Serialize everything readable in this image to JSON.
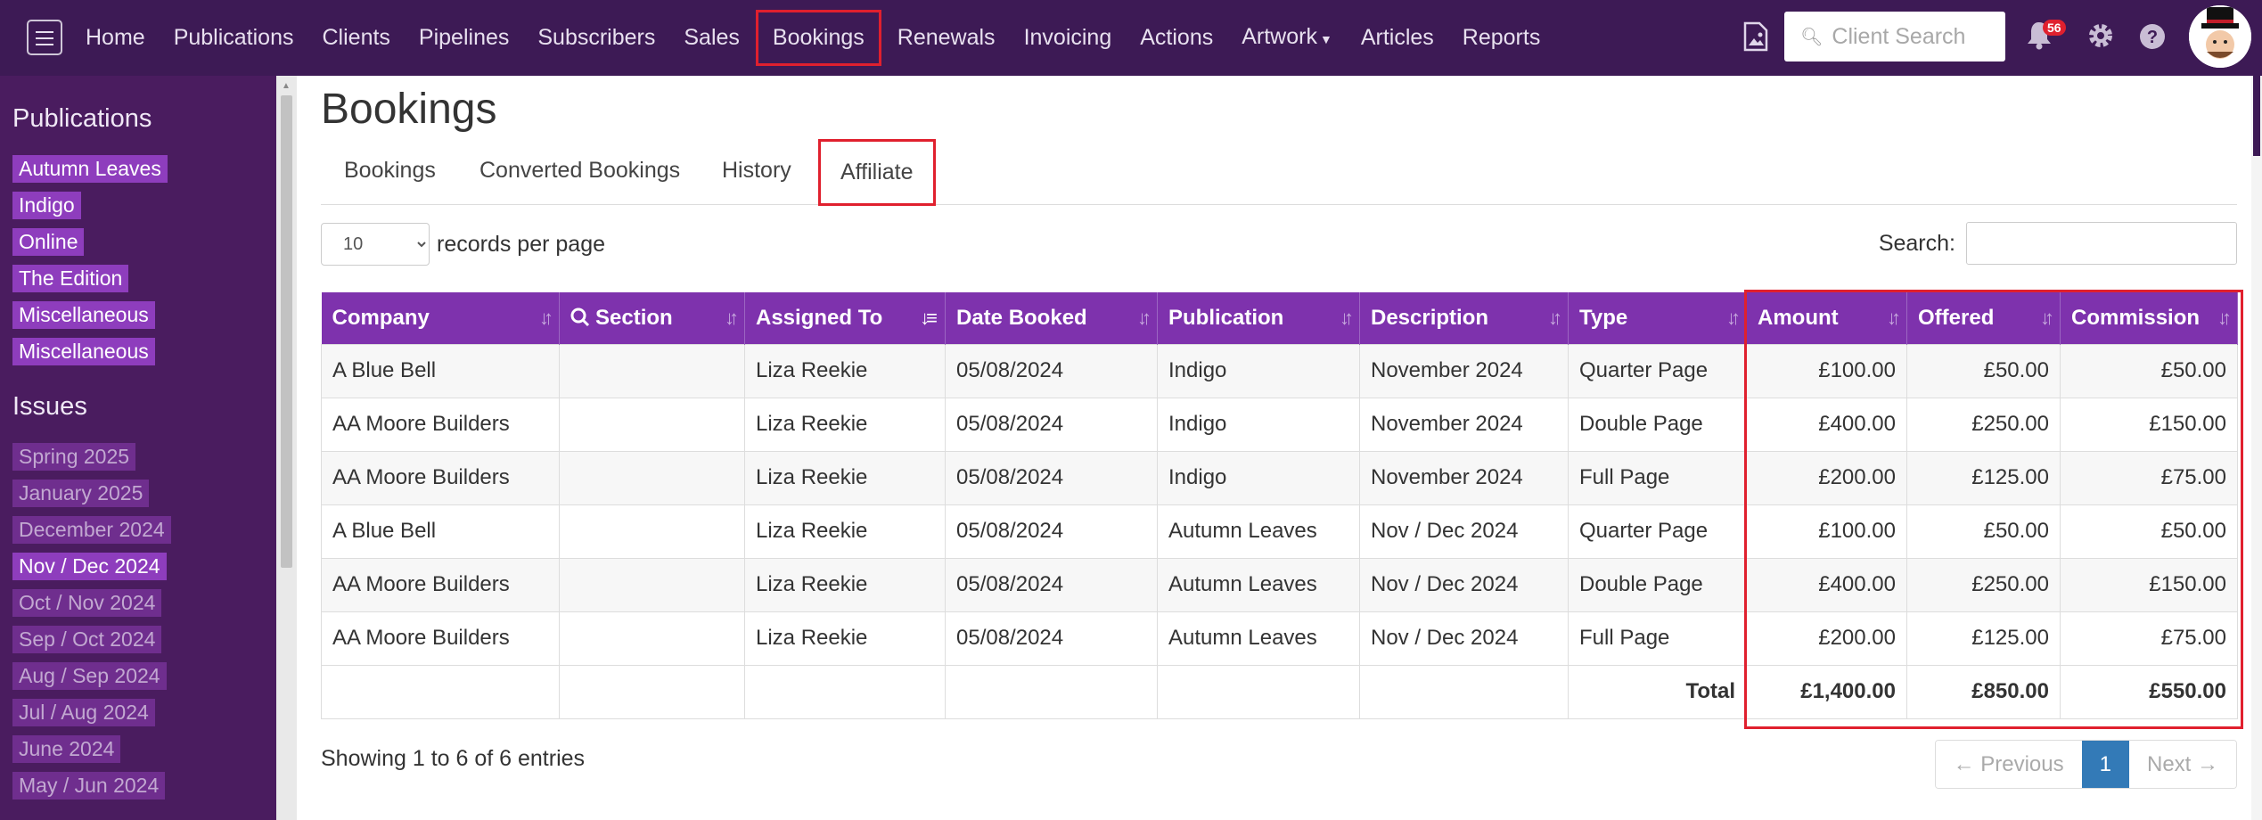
{
  "nav": {
    "items": [
      "Home",
      "Publications",
      "Clients",
      "Pipelines",
      "Subscribers",
      "Sales",
      "Bookings",
      "Renewals",
      "Invoicing",
      "Actions",
      "Artwork",
      "Articles",
      "Reports"
    ],
    "active": "Bookings",
    "search_placeholder": "Client Search",
    "notification_count": "56"
  },
  "sidebar": {
    "publications_heading": "Publications",
    "publications": [
      "Autumn Leaves",
      "Indigo",
      "Online",
      "The Edition",
      "Miscellaneous",
      "Miscellaneous"
    ],
    "issues_heading": "Issues",
    "issues": [
      "Spring 2025",
      "January 2025",
      "December 2024",
      "Nov / Dec 2024",
      "Oct / Nov 2024",
      "Sep / Oct 2024",
      "Aug / Sep 2024",
      "Jul / Aug 2024",
      "June 2024",
      "May / Jun 2024"
    ],
    "active_issue": "Nov / Dec 2024"
  },
  "page": {
    "title": "Bookings",
    "tabs": [
      "Bookings",
      "Converted Bookings",
      "History",
      "Affiliate"
    ],
    "active_tab": "Affiliate",
    "length_value": "10",
    "length_label": "records per page",
    "search_label": "Search:"
  },
  "table": {
    "columns": [
      "Company",
      "Section",
      "Assigned To",
      "Date Booked",
      "Publication",
      "Description",
      "Type",
      "Amount",
      "Offered",
      "Commission"
    ],
    "rows": [
      [
        "A Blue Bell",
        "",
        "Liza Reekie",
        "05/08/2024",
        "Indigo",
        "November 2024",
        "Quarter Page",
        "£100.00",
        "£50.00",
        "£50.00"
      ],
      [
        "AA Moore Builders",
        "",
        "Liza Reekie",
        "05/08/2024",
        "Indigo",
        "November 2024",
        "Double Page",
        "£400.00",
        "£250.00",
        "£150.00"
      ],
      [
        "AA Moore Builders",
        "",
        "Liza Reekie",
        "05/08/2024",
        "Indigo",
        "November 2024",
        "Full Page",
        "£200.00",
        "£125.00",
        "£75.00"
      ],
      [
        "A Blue Bell",
        "",
        "Liza Reekie",
        "05/08/2024",
        "Autumn Leaves",
        "Nov / Dec 2024",
        "Quarter Page",
        "£100.00",
        "£50.00",
        "£50.00"
      ],
      [
        "AA Moore Builders",
        "",
        "Liza Reekie",
        "05/08/2024",
        "Autumn Leaves",
        "Nov / Dec 2024",
        "Double Page",
        "£400.00",
        "£250.00",
        "£150.00"
      ],
      [
        "AA Moore Builders",
        "",
        "Liza Reekie",
        "05/08/2024",
        "Autumn Leaves",
        "Nov / Dec 2024",
        "Full Page",
        "£200.00",
        "£125.00",
        "£75.00"
      ]
    ],
    "total_label": "Total",
    "totals": [
      "£1,400.00",
      "£850.00",
      "£550.00"
    ]
  },
  "footer": {
    "info": "Showing 1 to 6 of 6 entries",
    "prev": "← Previous",
    "page": "1",
    "next": "Next →"
  },
  "colors": {
    "navbar": "#3d1a55",
    "sidebar": "#4a1c5f",
    "table_header": "#7e32ad",
    "highlight": "#e0202e",
    "pagination_active": "#337ab7"
  }
}
